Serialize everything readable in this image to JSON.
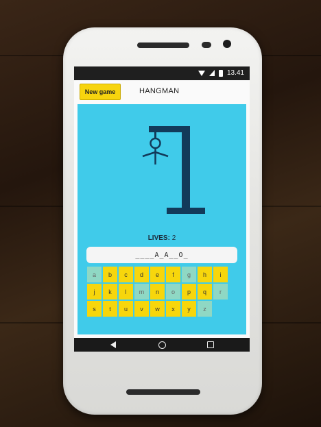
{
  "status_bar": {
    "time": "13.41"
  },
  "app_bar": {
    "new_game_label": "New game",
    "title": "HANGMAN"
  },
  "game": {
    "lives_label": "LIVES:",
    "lives_value": "2",
    "word_display": "____A_A__O_"
  },
  "keyboard": {
    "rows": [
      [
        {
          "letter": "a",
          "used": true
        },
        {
          "letter": "b",
          "used": false
        },
        {
          "letter": "c",
          "used": false
        },
        {
          "letter": "d",
          "used": false
        },
        {
          "letter": "e",
          "used": false
        },
        {
          "letter": "f",
          "used": false
        },
        {
          "letter": "g",
          "used": true
        },
        {
          "letter": "h",
          "used": false
        },
        {
          "letter": "i",
          "used": false
        }
      ],
      [
        {
          "letter": "j",
          "used": false
        },
        {
          "letter": "k",
          "used": false
        },
        {
          "letter": "l",
          "used": false
        },
        {
          "letter": "m",
          "used": true
        },
        {
          "letter": "n",
          "used": false
        },
        {
          "letter": "o",
          "used": true
        },
        {
          "letter": "p",
          "used": false
        },
        {
          "letter": "q",
          "used": false
        },
        {
          "letter": "r",
          "used": true
        }
      ],
      [
        {
          "letter": "s",
          "used": false
        },
        {
          "letter": "t",
          "used": false
        },
        {
          "letter": "u",
          "used": false
        },
        {
          "letter": "v",
          "used": false
        },
        {
          "letter": "w",
          "used": false
        },
        {
          "letter": "x",
          "used": false
        },
        {
          "letter": "y",
          "used": false
        },
        {
          "letter": "z",
          "used": true
        }
      ]
    ]
  },
  "colors": {
    "game_background": "#40cbea",
    "key_available": "#f7d60c",
    "key_used": "#8fd8c4",
    "gallows": "#123a5a"
  },
  "icons": [
    "wifi-icon",
    "signal-icon",
    "battery-icon",
    "back-icon",
    "home-icon",
    "recent-apps-icon"
  ]
}
